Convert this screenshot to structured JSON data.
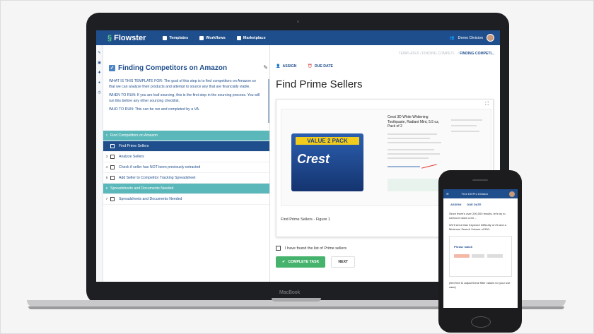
{
  "app": {
    "brand": "Flowster",
    "nav": [
      {
        "label": "Templates"
      },
      {
        "label": "Workflows"
      },
      {
        "label": "Marketplace"
      }
    ],
    "user_label": "Demo Division",
    "breadcrumb_prefix": "TEMPLATES  /  FINDING COMPETI...  /",
    "breadcrumb_current": "FINDING COMPETI..."
  },
  "left": {
    "title": "Finding Competitors on Amazon",
    "paragraphs": [
      "WHAT IS THIS TEMPLATE FOR: The goal of this step is to find competitors on Amazon so that we can analyze their products and attempt to source any that are financially viable.",
      "WHEN TO RUN: If you are leaf sourcing, this is the first step in the sourcing process. You will run this before any other sourcing checklist.",
      "WHO TO RUN: This can be run and completed by a VA."
    ],
    "rows": [
      {
        "num": "1",
        "label": "Find Competitors on Amazon",
        "type": "section"
      },
      {
        "num": "2",
        "label": "Find Prime Sellers",
        "type": "active"
      },
      {
        "num": "3",
        "label": "Analyze Sellers",
        "type": "step"
      },
      {
        "num": "4",
        "label": "Check if seller has NOT been previously extracted",
        "type": "step"
      },
      {
        "num": "5",
        "label": "Add Seller to Competitor Tracking Spreadsheet",
        "type": "step"
      },
      {
        "num": "6",
        "label": "Spreadsheets and Documents Needed",
        "type": "section"
      },
      {
        "num": "7",
        "label": "Spreadsheets and Documents Needed",
        "type": "step"
      }
    ]
  },
  "right": {
    "assign_label": "ASSIGN",
    "due_label": "DUE DATE",
    "title": "Find Prime Sellers",
    "figure_caption": "Find Prime Sellers - Figure 1",
    "screenshot_banner": "VALUE 2 PACK",
    "screenshot_brand": "Crest",
    "screenshot_product": "Crest 3D White Whitening Toothpaste, Radiant Mint, 5.5 oz, Pack of 2",
    "checkbox_label": "I have found the list of Prime sellers",
    "complete_label": "COMPLETE TASK",
    "next_label": "NEXT"
  },
  "laptop_label": "MacBook",
  "phone": {
    "title": "Free DIVPro Division",
    "assign_label": "ASSIGN",
    "due_label": "DUE DATE",
    "intro": "Since there's over 200,000 results, let's try to narrow it down a bit ...",
    "filter_text": "We'll set a Max Keyword Difficulty of 25 and a Minimum Search Volume of 500:",
    "card_title": "Phrase match",
    "footer_text": "(feel free to adjust these filter values for your use case)"
  },
  "colors": {
    "primary": "#1f4e8c",
    "section": "#5bb8ba",
    "success": "#45b36b"
  }
}
